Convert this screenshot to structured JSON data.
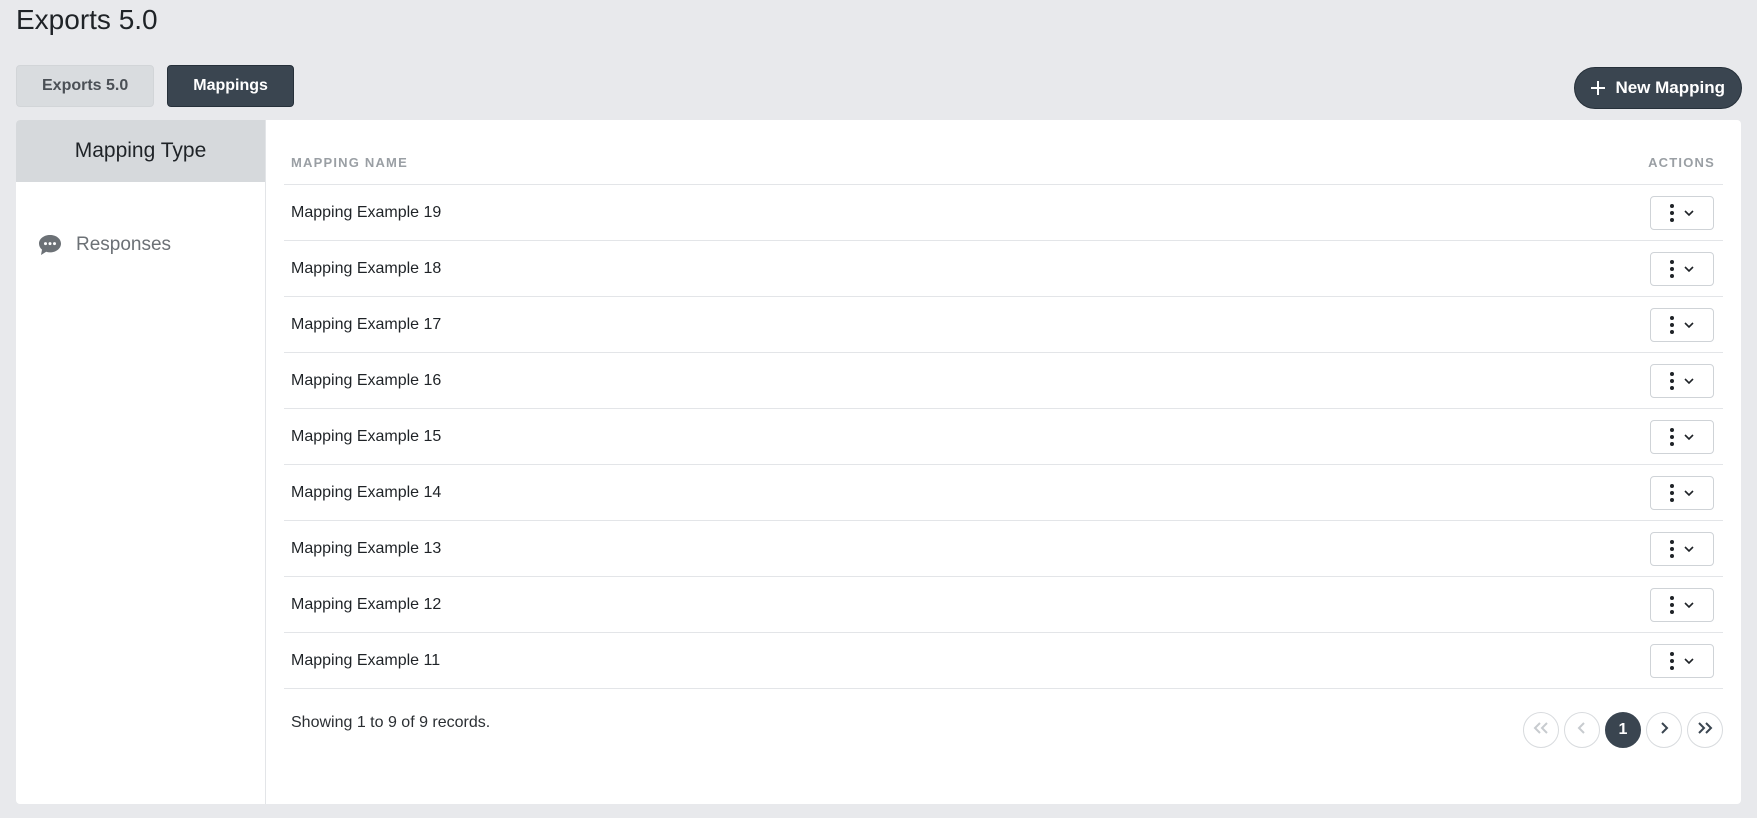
{
  "page": {
    "title": "Exports 5.0"
  },
  "tabs": [
    {
      "label": "Exports 5.0",
      "active": false
    },
    {
      "label": "Mappings",
      "active": true
    }
  ],
  "new_button": {
    "label": "New Mapping",
    "icon": "plus-icon"
  },
  "sidebar": {
    "header": "Mapping Type",
    "items": [
      {
        "label": "Responses",
        "icon": "chat-bubble-icon"
      }
    ]
  },
  "table": {
    "columns": {
      "name": "MAPPING NAME",
      "actions": "ACTIONS"
    },
    "rows": [
      {
        "name": "Mapping Example 19"
      },
      {
        "name": "Mapping Example 18"
      },
      {
        "name": "Mapping Example 17"
      },
      {
        "name": "Mapping Example 16"
      },
      {
        "name": "Mapping Example 15"
      },
      {
        "name": "Mapping Example 14"
      },
      {
        "name": "Mapping Example 13"
      },
      {
        "name": "Mapping Example 12"
      },
      {
        "name": "Mapping Example 11"
      }
    ]
  },
  "footer": {
    "records_text": "Showing 1 to 9 of 9 records.",
    "current_page": "1"
  },
  "colors": {
    "primary": "#3a4550",
    "background": "#e8e9ec"
  }
}
